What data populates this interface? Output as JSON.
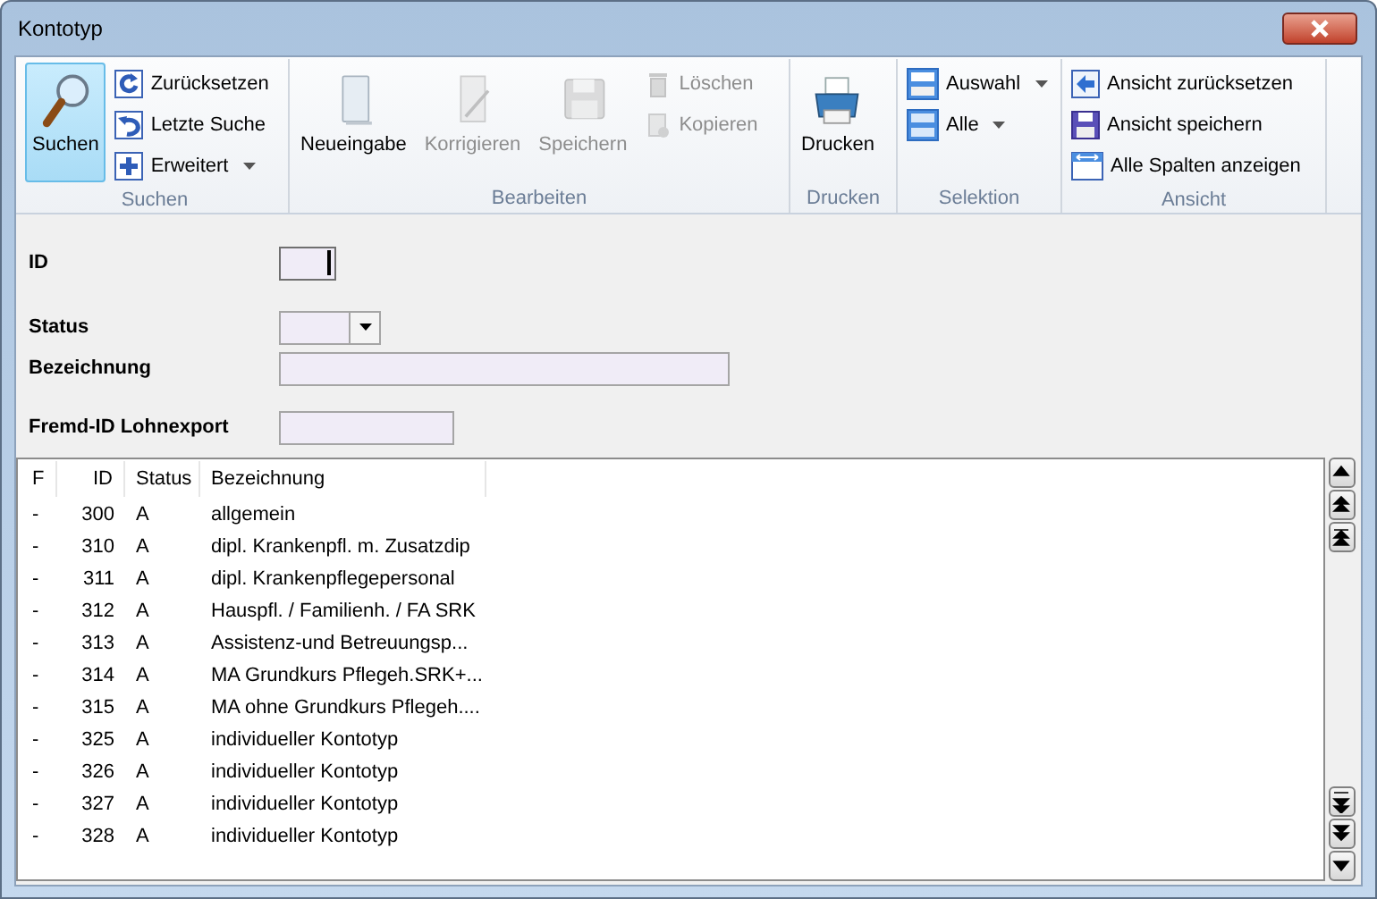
{
  "window": {
    "title": "Kontotyp"
  },
  "ribbon": [
    {
      "label": "Suchen",
      "items": [
        {
          "label": "Suchen",
          "kind": "large",
          "selected": true,
          "disabled": false
        },
        {
          "label": "Zurücksetzen",
          "kind": "small",
          "selected": false,
          "disabled": false
        },
        {
          "label": "Letzte Suche",
          "kind": "small",
          "selected": false,
          "disabled": false
        },
        {
          "label": "Erweitert",
          "kind": "small",
          "selected": false,
          "disabled": false,
          "dropdown": true
        }
      ]
    },
    {
      "label": "Bearbeiten",
      "items": [
        {
          "label": "Neueingabe",
          "kind": "large",
          "selected": false,
          "disabled": false
        },
        {
          "label": "Korrigieren",
          "kind": "large",
          "selected": false,
          "disabled": true
        },
        {
          "label": "Speichern",
          "kind": "large",
          "selected": false,
          "disabled": true
        },
        {
          "label": "Löschen",
          "kind": "small",
          "selected": false,
          "disabled": true
        },
        {
          "label": "Kopieren",
          "kind": "small",
          "selected": false,
          "disabled": true
        }
      ]
    },
    {
      "label": "Drucken",
      "items": [
        {
          "label": "Drucken",
          "kind": "large",
          "selected": false,
          "disabled": false
        }
      ]
    },
    {
      "label": "Selektion",
      "items": [
        {
          "label": "Auswahl",
          "kind": "small",
          "selected": false,
          "disabled": false,
          "dropdown": true
        },
        {
          "label": "Alle",
          "kind": "small",
          "selected": false,
          "disabled": false,
          "dropdown": true
        }
      ]
    },
    {
      "label": "Ansicht",
      "items": [
        {
          "label": "Ansicht zurücksetzen",
          "kind": "small",
          "selected": false,
          "disabled": false
        },
        {
          "label": "Ansicht speichern",
          "kind": "small",
          "selected": false,
          "disabled": false
        },
        {
          "label": "Alle Spalten anzeigen",
          "kind": "small",
          "selected": false,
          "disabled": false
        }
      ]
    }
  ],
  "form": [
    {
      "label": "ID",
      "kind": "text",
      "focused": true
    },
    {
      "label": "Status",
      "kind": "combo"
    },
    {
      "label": "Bezeichnung",
      "kind": "wide",
      "focused": false
    },
    {
      "label": "Fremd-ID Lohnexport",
      "kind": "medium",
      "focused": false
    }
  ],
  "table": {
    "columns": [
      "F",
      "ID",
      "Status",
      "Bezeichnung"
    ],
    "rows": [
      [
        "-",
        "300",
        "A",
        "allgemein"
      ],
      [
        "-",
        "310",
        "A",
        "dipl. Krankenpfl. m. Zusatzdip"
      ],
      [
        "-",
        "311",
        "A",
        "dipl. Krankenpflegepersonal"
      ],
      [
        "-",
        "312",
        "A",
        "Hauspfl. / Familienh. / FA SRK"
      ],
      [
        "-",
        "313",
        "A",
        "Assistenz-und Betreuungsp..."
      ],
      [
        "-",
        "314",
        "A",
        "MA Grundkurs Pflegeh.SRK+..."
      ],
      [
        "-",
        "315",
        "A",
        "MA ohne Grundkurs Pflegeh...."
      ],
      [
        "-",
        "325",
        "A",
        "individueller Kontotyp"
      ],
      [
        "-",
        "326",
        "A",
        "individueller Kontotyp"
      ],
      [
        "-",
        "327",
        "A",
        "individueller Kontotyp"
      ],
      [
        "-",
        "328",
        "A",
        "individueller Kontotyp"
      ]
    ]
  }
}
